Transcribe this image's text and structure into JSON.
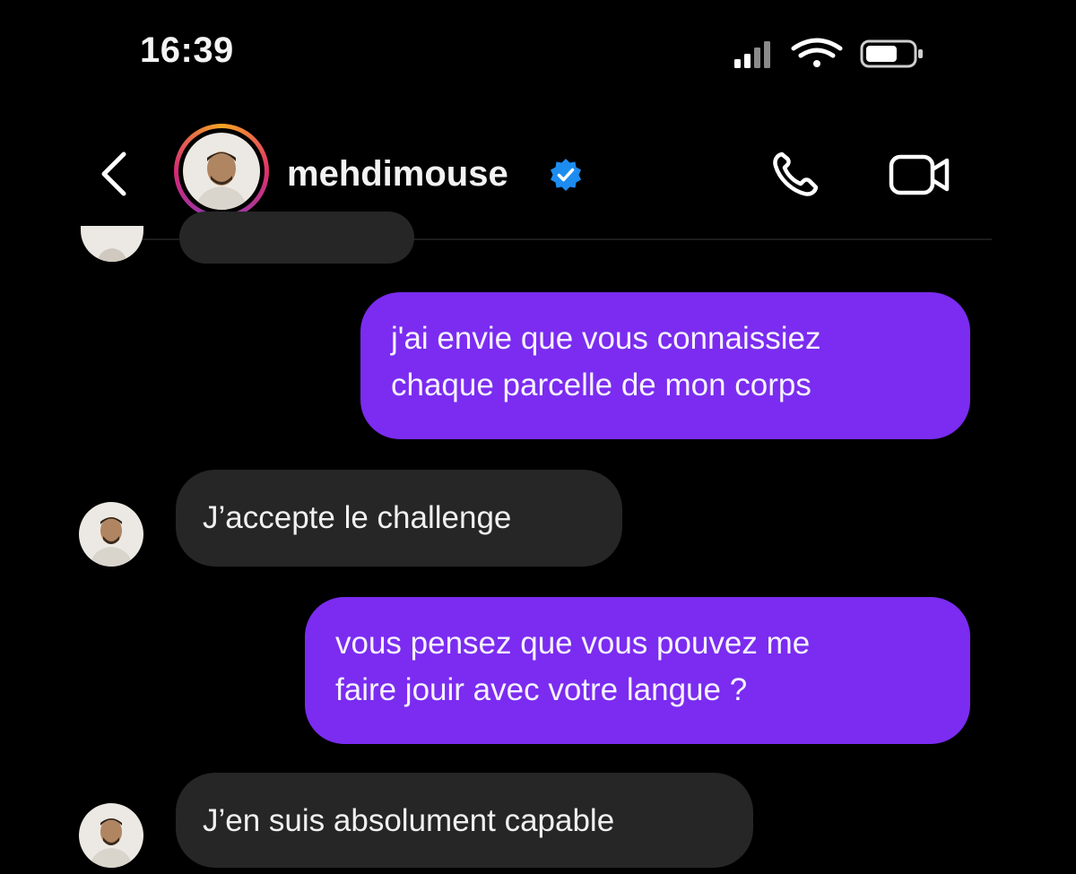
{
  "status_bar": {
    "time": "16:39",
    "icons": [
      "cellular-signal-icon",
      "wifi-icon",
      "battery-icon"
    ]
  },
  "header": {
    "back_icon": "chevron-left-icon",
    "username": "mehdimouse",
    "verified": true,
    "actions": [
      "phone-call-icon",
      "video-call-icon"
    ]
  },
  "messages": [
    {
      "direction": "sent",
      "lines": [
        "j'ai envie que vous connaissiez",
        "chaque parcelle de mon corps"
      ]
    },
    {
      "direction": "received",
      "lines": [
        "J’accepte le challenge"
      ]
    },
    {
      "direction": "sent",
      "lines": [
        "vous pensez que vous pouvez me",
        "faire jouir avec votre langue ?"
      ]
    },
    {
      "direction": "received",
      "lines": [
        "J’en suis absolument capable"
      ]
    }
  ],
  "colors": {
    "background": "#000000",
    "sent_bubble": "#7b2cf0",
    "received_bubble": "#262626",
    "verified_badge": "#1d8cf0"
  }
}
